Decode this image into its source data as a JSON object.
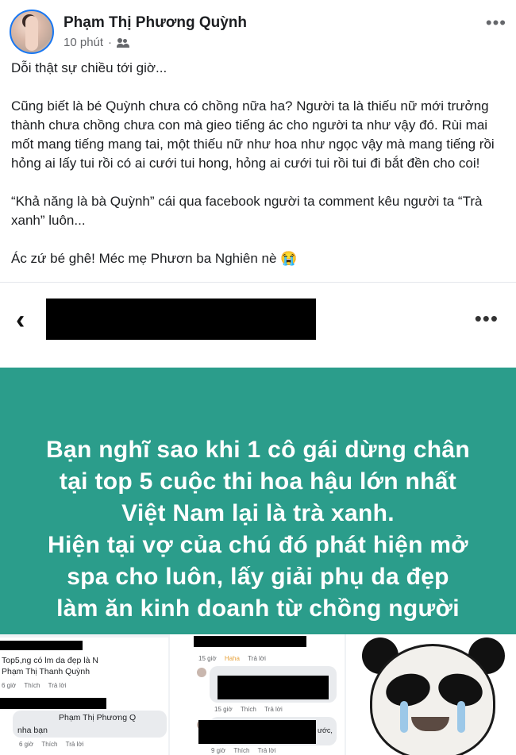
{
  "header": {
    "author": "Phạm Thị Phương Quỳnh",
    "time": "10 phút",
    "separator": "·",
    "more": "•••"
  },
  "post": {
    "paragraphs": [
      "Dỗi thật sự chiều tới giờ...",
      "Cũng biết là bé Quỳnh chưa có chồng nữa ha? Người ta là thiếu nữ mới trưởng thành chưa chồng chưa con mà gieo tiếng ác cho người ta như vậy đó. Rùi mai mốt mang tiếng mang tai, một thiếu nữ như hoa như ngọc vậy mà mang tiếng rồi hỏng ai lấy tui rồi có ai cưới tui hong, hỏng ai cưới tui rồi tui đi bắt đền cho coi!",
      "“Khả năng là bà Quỳnh” cái qua facebook người ta comment kêu người ta “Trà xanh” luôn...",
      "Ác zứ bé ghê! Méc mẹ Phươn ba Nghiên nè 😭"
    ]
  },
  "screenshot": {
    "back": "‹",
    "more": "•••",
    "green_lines": [
      "Bạn nghĩ sao khi 1 cô gái dừng chân",
      "tại top 5 cuộc thi hoa hậu lớn nhất",
      "Việt Nam lại là trà xanh.",
      "Hiện tại vợ của chú đó phát hiện mở",
      "spa cho luôn, lấy giải phụ da đẹp",
      "làm ăn kinh doanh từ chồng người"
    ],
    "colors": {
      "green_bg": "#2b9d8b",
      "accent": "#1877f2"
    }
  },
  "collage": {
    "left": {
      "c1_text": "Top5,ng có lm da đẹp là N",
      "c1_name": "Phạm Thị Thanh Quỳnh",
      "c1_time": "6 giờ",
      "c1_like": "Thích",
      "c1_reply": "Trả lời",
      "c2_name": "Phạm Thị Phương Q",
      "c2_text": "nha bạn",
      "c2_time": "6 giờ",
      "c2_like": "Thích",
      "c2_reply": "Trả lời"
    },
    "middle": {
      "r1_time": "15 giờ",
      "r1_haha": "Haha",
      "r1_reply": "Trả lời",
      "r2_time": "15 giờ",
      "r2_like": "Thích",
      "r2_reply": "Trả lời",
      "r3_text": "ước,",
      "r3_time": "9 giờ",
      "r3_like": "Thích",
      "r3_reply": "Trả lời"
    }
  }
}
